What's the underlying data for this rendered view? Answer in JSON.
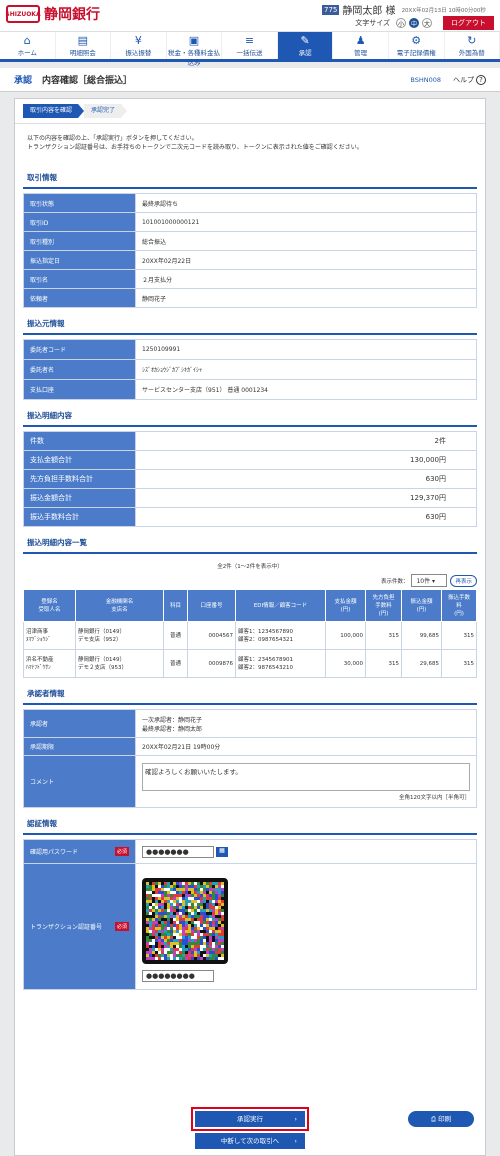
{
  "header": {
    "bank_name": "静岡銀行",
    "logo_mark": "SHIZUOKA",
    "user_id_badge": "775",
    "user_name": "静岡太郎 様",
    "datetime": "20XX年02月13日 10時00分00秒",
    "text_size_label": "文字サイズ",
    "text_sizes": [
      "小",
      "中",
      "大"
    ],
    "logout_label": "ログアウト"
  },
  "nav": [
    {
      "label": "ホーム",
      "icon": "⌂"
    },
    {
      "label": "明細照会",
      "icon": "▤"
    },
    {
      "label": "振込振替",
      "icon": "¥"
    },
    {
      "label": "税金・各種料金払込み",
      "icon": "▣"
    },
    {
      "label": "一括伝送",
      "icon": "≡"
    },
    {
      "label": "承認",
      "icon": "✎"
    },
    {
      "label": "管理",
      "icon": "♟"
    },
    {
      "label": "電子記録債権",
      "icon": "⚙"
    },
    {
      "label": "外国為替",
      "icon": "↻"
    }
  ],
  "titlebar": {
    "category": "承認",
    "title": "内容確認［総合振込］",
    "screen_id": "BSHN008",
    "help_label": "ヘルプ",
    "help_icon": "?"
  },
  "steps": [
    "取引内容を確認",
    "承認完了"
  ],
  "note": {
    "line1": "以下の内容を確認の上、「承認実行」ボタンを押してください。",
    "line2": "トランザクション認証番号は、お手持ちのトークンで二次元コードを読み取り、トークンに表示された値をご確認ください。"
  },
  "torihiki": {
    "heading": "取引情報",
    "rows": [
      {
        "k": "取引状態",
        "v": "最終承認待ち"
      },
      {
        "k": "取引ID",
        "v": "101001000000121"
      },
      {
        "k": "取引種別",
        "v": "総合振込"
      },
      {
        "k": "振込指定日",
        "v": "20XX年02月22日"
      },
      {
        "k": "取引名",
        "v": "２月支払分"
      },
      {
        "k": "依頼者",
        "v": "静岡花子"
      }
    ]
  },
  "furikomimoto": {
    "heading": "振込元情報",
    "rows": [
      {
        "k": "委託者コード",
        "v": "1250109991"
      },
      {
        "k": "委託者名",
        "v": "ｼｽﾞｵｶｼｮｳｼﾞｶﾌﾞｼｷｶﾞｲｼｬ"
      },
      {
        "k": "支払口座",
        "v": "サービスセンター支店（951） 普通 0001234"
      }
    ]
  },
  "meisai": {
    "heading": "振込明細内容",
    "rows": [
      {
        "k": "件数",
        "v": "2件"
      },
      {
        "k": "支払金額合計",
        "v": "130,000円"
      },
      {
        "k": "先方負担手数料合計",
        "v": "630円"
      },
      {
        "k": "振込金額合計",
        "v": "129,370円"
      },
      {
        "k": "振込手数料合計",
        "v": "630円"
      }
    ]
  },
  "list": {
    "heading": "振込明細内容一覧",
    "count_text": "全2件（1～2件を表示中）",
    "per_page_label": "表示件数：",
    "per_page_value": "10件",
    "redisplay_label": "再表示",
    "columns": [
      "登録名\n受取人名",
      "金融機関名\n支店名",
      "科目",
      "口座番号",
      "EDI情報／顧客コード",
      "支払金額\n(円)",
      "先方負担\n手数料\n(円)",
      "振込金額\n(円)",
      "振込手数\n料\n(円)"
    ],
    "rows": [
      {
        "name": "沼津商事",
        "kana": "ﾇﾏﾂﾞｼｮｳｼﾞ",
        "bank": "静岡銀行（0149）",
        "branch": "デモ支店（952）",
        "type": "普通",
        "acct": "0004567",
        "edi1": "顧客1：1234567890",
        "edi2": "顧客2：0987654321",
        "pay": "100,000",
        "fee_other": "315",
        "amount": "99,685",
        "fee": "315"
      },
      {
        "name": "浜名不動産",
        "kana": "ﾊﾏﾅﾌﾄﾞｳｻﾝ",
        "bank": "静岡銀行（0149）",
        "branch": "デモ２支店（953）",
        "type": "普通",
        "acct": "0009876",
        "edi1": "顧客1：2345678901",
        "edi2": "顧客2：9876543210",
        "pay": "30,000",
        "fee_other": "315",
        "amount": "29,685",
        "fee": "315"
      }
    ]
  },
  "approver": {
    "heading": "承認者情報",
    "approver_label": "承認者",
    "approver_line1": "一次承認者：静岡花子",
    "approver_line2": "最終承認者：静岡太郎",
    "deadline_label": "承認期限",
    "deadline": "20XX年02月21日 19時00分",
    "comment_label": "コメント",
    "comment": "確認よろしくお願いいたします。",
    "comment_limit": "全角120文字以内［半角可］"
  },
  "auth": {
    "heading": "認証情報",
    "pw_label": "確認用パスワード",
    "required": "必須",
    "pw_value": "●●●●●●●",
    "tx_label": "トランザクション認証番号",
    "tx_value": "●●●●●●●●",
    "keyboard_icon": "▦"
  },
  "buttons": {
    "approve": "承認実行",
    "interrupt": "中断して次の取引へ",
    "print": "印刷",
    "arrow": "›",
    "print_icon": "⎙"
  }
}
